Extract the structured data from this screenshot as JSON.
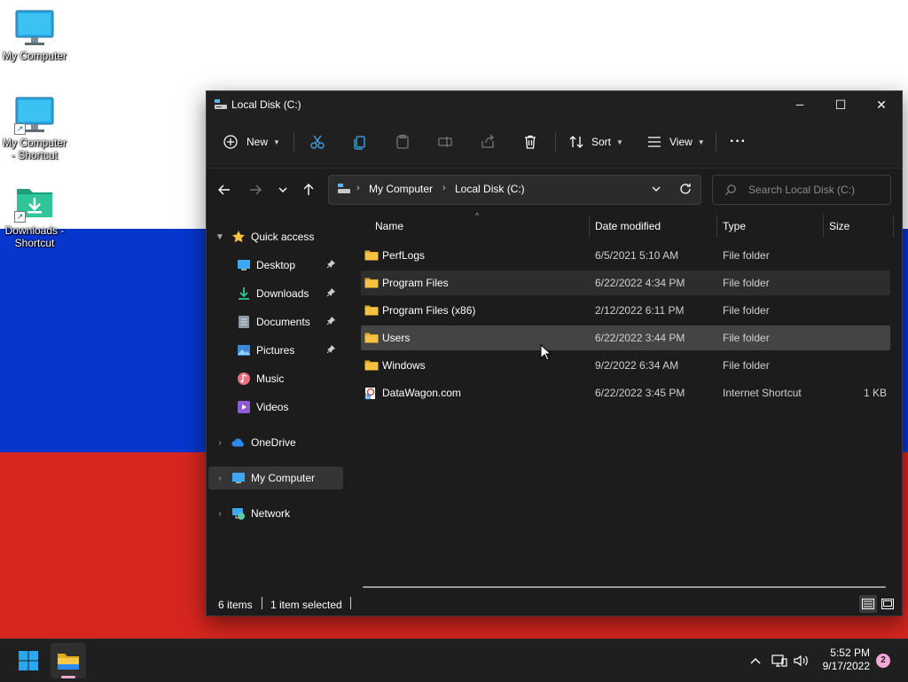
{
  "colors": {
    "flag_white": "#ffffff",
    "flag_blue": "#0636cc",
    "flag_red": "#d7261f",
    "window_bg": "#1c1c1c",
    "folder_yellow": "#f5c242",
    "selection_bg": "#444444",
    "notification_badge": "#f3a6d8"
  },
  "desktop": {
    "icons": [
      {
        "label": "My Computer",
        "icon": "monitor-icon",
        "shortcut": false
      },
      {
        "label": "My Computer - Shortcut",
        "icon": "monitor-icon",
        "shortcut": true
      },
      {
        "label": "Downloads - Shortcut",
        "icon": "downloads-folder-icon",
        "shortcut": true
      }
    ]
  },
  "window": {
    "title": "Local Disk (C:)",
    "controls": {
      "minimize": "─",
      "maximize": "☐",
      "close": "✕"
    }
  },
  "toolbar": {
    "new_label": "New",
    "sort_label": "Sort",
    "view_label": "View",
    "more_label": "···",
    "icons": [
      "cut-icon",
      "copy-icon",
      "paste-icon",
      "rename-icon",
      "share-icon",
      "delete-icon"
    ]
  },
  "address": {
    "segments": [
      "My Computer",
      "Local Disk (C:)"
    ],
    "search_placeholder": "Search Local Disk (C:)"
  },
  "sidebar": {
    "quick_access": "Quick access",
    "items": [
      {
        "label": "Desktop",
        "icon": "desktop-icon",
        "pinned": true
      },
      {
        "label": "Downloads",
        "icon": "downloads-icon",
        "pinned": true
      },
      {
        "label": "Documents",
        "icon": "documents-icon",
        "pinned": true
      },
      {
        "label": "Pictures",
        "icon": "pictures-icon",
        "pinned": true
      },
      {
        "label": "Music",
        "icon": "music-icon",
        "pinned": false
      },
      {
        "label": "Videos",
        "icon": "videos-icon",
        "pinned": false
      }
    ],
    "onedrive": "OneDrive",
    "my_computer": "My Computer",
    "network": "Network"
  },
  "columns": [
    "Name",
    "Date modified",
    "Type",
    "Size"
  ],
  "files": [
    {
      "name": "PerfLogs",
      "date": "6/5/2021 5:10 AM",
      "type": "File folder",
      "size": "",
      "icon": "folder-icon",
      "state": "normal"
    },
    {
      "name": "Program Files",
      "date": "6/22/2022 4:34 PM",
      "type": "File folder",
      "size": "",
      "icon": "folder-icon",
      "state": "hover"
    },
    {
      "name": "Program Files (x86)",
      "date": "2/12/2022 6:11 PM",
      "type": "File folder",
      "size": "",
      "icon": "folder-icon",
      "state": "normal"
    },
    {
      "name": "Users",
      "date": "6/22/2022 3:44 PM",
      "type": "File folder",
      "size": "",
      "icon": "folder-icon",
      "state": "selected"
    },
    {
      "name": "Windows",
      "date": "9/2/2022 6:34 AM",
      "type": "File folder",
      "size": "",
      "icon": "folder-icon",
      "state": "normal"
    },
    {
      "name": "DataWagon.com",
      "date": "6/22/2022 3:45 PM",
      "type": "Internet Shortcut",
      "size": "1 KB",
      "icon": "internet-shortcut-icon",
      "state": "normal"
    }
  ],
  "status": {
    "items_count": "6 items",
    "selected": "1 item selected"
  },
  "taskbar": {
    "time": "5:52 PM",
    "date": "9/17/2022",
    "notifications": "2"
  }
}
